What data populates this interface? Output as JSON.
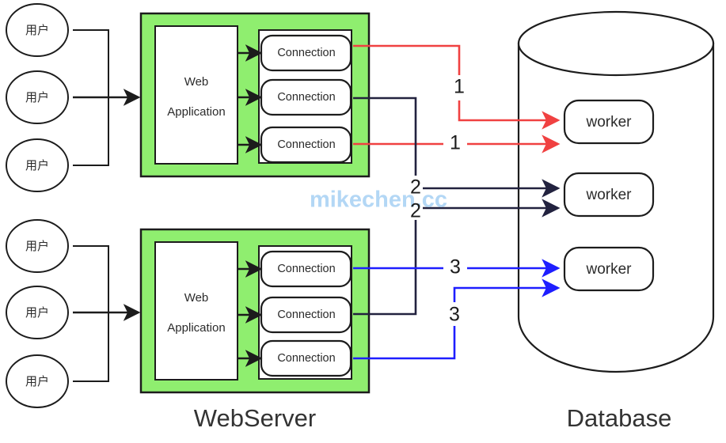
{
  "diagram": {
    "title_webserver": "WebServer",
    "title_database": "Database",
    "watermark": "mikechen.cc",
    "colors": {
      "green_panel": "#8FEE6F",
      "flow_red": "#F04141",
      "flow_navy": "#22223F",
      "flow_blue": "#1E1EFF",
      "stroke": "#1c1c1c",
      "watermark": "#b3d7f5",
      "text": "#2b2b2b"
    },
    "users": {
      "group_top": [
        {
          "label": "用户"
        },
        {
          "label": "用户"
        },
        {
          "label": "用户"
        }
      ],
      "group_bottom": [
        {
          "label": "用户"
        },
        {
          "label": "用户"
        },
        {
          "label": "用户"
        }
      ]
    },
    "webservers": [
      {
        "id": "webserver-top",
        "app_line1": "Web",
        "app_line2": "Application",
        "connections": [
          {
            "label": "Connection"
          },
          {
            "label": "Connection"
          },
          {
            "label": "Connection"
          }
        ]
      },
      {
        "id": "webserver-bottom",
        "app_line1": "Web",
        "app_line2": "Application",
        "connections": [
          {
            "label": "Connection"
          },
          {
            "label": "Connection"
          },
          {
            "label": "Connection"
          }
        ]
      }
    ],
    "database": {
      "workers": [
        {
          "label": "worker"
        },
        {
          "label": "worker"
        },
        {
          "label": "worker"
        }
      ]
    },
    "flow_labels": [
      {
        "id": "flow-1-a",
        "text": "1",
        "color": "#F04141"
      },
      {
        "id": "flow-1-b",
        "text": "1",
        "color": "#F04141"
      },
      {
        "id": "flow-2-a",
        "text": "2",
        "color": "#22223F"
      },
      {
        "id": "flow-2-b",
        "text": "2",
        "color": "#22223F"
      },
      {
        "id": "flow-3-a",
        "text": "3",
        "color": "#1E1EFF"
      },
      {
        "id": "flow-3-b",
        "text": "3",
        "color": "#1E1EFF"
      }
    ]
  }
}
